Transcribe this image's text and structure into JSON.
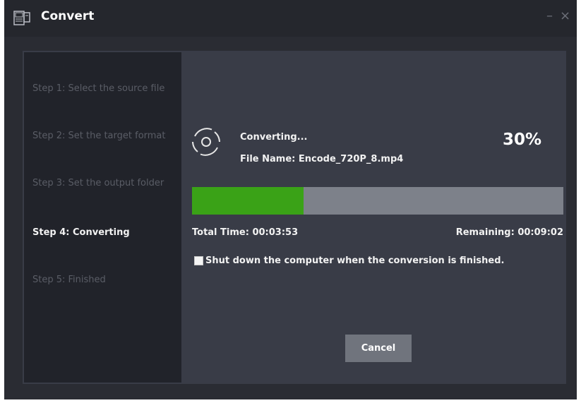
{
  "window": {
    "title": "Convert",
    "minimize_glyph": "–",
    "close_glyph": "×"
  },
  "steps": [
    {
      "label": "Step 1: Select the source file",
      "state": "inactive"
    },
    {
      "label": "Step 2: Set the target format",
      "state": "inactive"
    },
    {
      "label": "Step 3: Set the output folder",
      "state": "inactive"
    },
    {
      "label": "Step 4: Converting",
      "state": "active"
    },
    {
      "label": "Step 5: Finished",
      "state": "inactive"
    }
  ],
  "conversion": {
    "status": "Converting...",
    "file_name": "File Name: Encode_720P_8.mp4",
    "percent_label": "30%",
    "progress_fraction": 0.3,
    "total_time": "Total Time: 00:03:53",
    "remaining": "Remaining: 00:09:02"
  },
  "shutdown_option": {
    "label": "Shut down the computer when the conversion is finished.",
    "checked": false
  },
  "buttons": {
    "cancel": "Cancel"
  },
  "icons": {
    "app": "convert-app-icon",
    "spinner": "disc-spinner-icon"
  },
  "colors": {
    "progress_fill": "#3aa217",
    "progress_track": "#7d818a",
    "sidebar_bg": "#21232a",
    "panel_bg": "#393c47",
    "active_step": "#f2f2f2",
    "inactive_step": "#5a5d66"
  }
}
